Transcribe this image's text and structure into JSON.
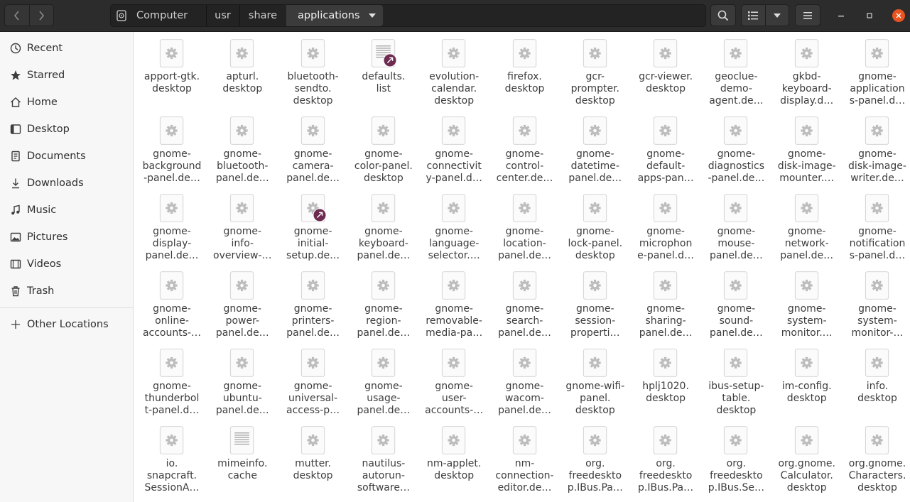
{
  "path": [
    "Computer",
    "usr",
    "share",
    "applications"
  ],
  "sidebar": [
    {
      "label": "Recent",
      "icon": "clock-icon"
    },
    {
      "label": "Starred",
      "icon": "star-icon"
    },
    {
      "label": "Home",
      "icon": "home-icon"
    },
    {
      "label": "Desktop",
      "icon": "desktop-icon"
    },
    {
      "label": "Documents",
      "icon": "documents-icon"
    },
    {
      "label": "Downloads",
      "icon": "downloads-icon"
    },
    {
      "label": "Music",
      "icon": "music-icon"
    },
    {
      "label": "Pictures",
      "icon": "pictures-icon"
    },
    {
      "label": "Videos",
      "icon": "videos-icon"
    },
    {
      "label": "Trash",
      "icon": "trash-icon"
    },
    {
      "label": "Other Locations",
      "icon": "plus-icon"
    }
  ],
  "files": [
    {
      "name": "apport-gtk.\ndesktop",
      "type": "desktop"
    },
    {
      "name": "apturl.\ndesktop",
      "type": "desktop"
    },
    {
      "name": "bluetooth-\nsendto.\ndesktop",
      "type": "desktop"
    },
    {
      "name": "defaults.\nlist",
      "type": "text-link"
    },
    {
      "name": "evolution-\ncalendar.\ndesktop",
      "type": "desktop"
    },
    {
      "name": "firefox.\ndesktop",
      "type": "desktop"
    },
    {
      "name": "gcr-\nprompter.\ndesktop",
      "type": "desktop"
    },
    {
      "name": "gcr-viewer.\ndesktop",
      "type": "desktop"
    },
    {
      "name": "geoclue-\ndemo-\nagent.de…",
      "type": "desktop"
    },
    {
      "name": "gkbd-\nkeyboard-\ndisplay.d…",
      "type": "desktop"
    },
    {
      "name": "gnome-\napplication\ns-panel.d…",
      "type": "desktop"
    },
    {
      "name": "gnome-\nbackground\n-panel.de…",
      "type": "desktop"
    },
    {
      "name": "gnome-\nbluetooth-\npanel.de…",
      "type": "desktop"
    },
    {
      "name": "gnome-\ncamera-\npanel.de…",
      "type": "desktop"
    },
    {
      "name": "gnome-\ncolor-panel.\ndesktop",
      "type": "desktop"
    },
    {
      "name": "gnome-\nconnectivit\ny-panel.d…",
      "type": "desktop"
    },
    {
      "name": "gnome-\ncontrol-\ncenter.de…",
      "type": "desktop"
    },
    {
      "name": "gnome-\ndatetime-\npanel.de…",
      "type": "desktop"
    },
    {
      "name": "gnome-\ndefault-\napps-pan…",
      "type": "desktop"
    },
    {
      "name": "gnome-\ndiagnostics\n-panel.de…",
      "type": "desktop"
    },
    {
      "name": "gnome-\ndisk-image-\nmounter.…",
      "type": "desktop"
    },
    {
      "name": "gnome-\ndisk-image-\nwriter.de…",
      "type": "desktop"
    },
    {
      "name": "gnome-\ndisplay-\npanel.de…",
      "type": "desktop"
    },
    {
      "name": "gnome-\ninfo-\noverview-…",
      "type": "desktop"
    },
    {
      "name": "gnome-\ninitial-\nsetup.de…",
      "type": "desktop-link"
    },
    {
      "name": "gnome-\nkeyboard-\npanel.de…",
      "type": "desktop"
    },
    {
      "name": "gnome-\nlanguage-\nselector.…",
      "type": "desktop"
    },
    {
      "name": "gnome-\nlocation-\npanel.de…",
      "type": "desktop"
    },
    {
      "name": "gnome-\nlock-panel.\ndesktop",
      "type": "desktop"
    },
    {
      "name": "gnome-\nmicrophon\ne-panel.d…",
      "type": "desktop"
    },
    {
      "name": "gnome-\nmouse-\npanel.de…",
      "type": "desktop"
    },
    {
      "name": "gnome-\nnetwork-\npanel.de…",
      "type": "desktop"
    },
    {
      "name": "gnome-\nnotification\ns-panel.d…",
      "type": "desktop"
    },
    {
      "name": "gnome-\nonline-\naccounts-…",
      "type": "desktop"
    },
    {
      "name": "gnome-\npower-\npanel.de…",
      "type": "desktop"
    },
    {
      "name": "gnome-\nprinters-\npanel.de…",
      "type": "desktop"
    },
    {
      "name": "gnome-\nregion-\npanel.de…",
      "type": "desktop"
    },
    {
      "name": "gnome-\nremovable-\nmedia-pa…",
      "type": "desktop"
    },
    {
      "name": "gnome-\nsearch-\npanel.de…",
      "type": "desktop"
    },
    {
      "name": "gnome-\nsession-\nproperti…",
      "type": "desktop"
    },
    {
      "name": "gnome-\nsharing-\npanel.de…",
      "type": "desktop"
    },
    {
      "name": "gnome-\nsound-\npanel.de…",
      "type": "desktop"
    },
    {
      "name": "gnome-\nsystem-\nmonitor.…",
      "type": "desktop"
    },
    {
      "name": "gnome-\nsystem-\nmonitor-…",
      "type": "desktop"
    },
    {
      "name": "gnome-\nthunderbol\nt-panel.d…",
      "type": "desktop"
    },
    {
      "name": "gnome-\nubuntu-\npanel.de…",
      "type": "desktop"
    },
    {
      "name": "gnome-\nuniversal-\naccess-p…",
      "type": "desktop"
    },
    {
      "name": "gnome-\nusage-\npanel.de…",
      "type": "desktop"
    },
    {
      "name": "gnome-\nuser-\naccounts-…",
      "type": "desktop"
    },
    {
      "name": "gnome-\nwacom-\npanel.de…",
      "type": "desktop"
    },
    {
      "name": "gnome-wifi-\npanel.\ndesktop",
      "type": "desktop"
    },
    {
      "name": "hplj1020.\ndesktop",
      "type": "desktop"
    },
    {
      "name": "ibus-setup-\ntable.\ndesktop",
      "type": "desktop"
    },
    {
      "name": "im-config.\ndesktop",
      "type": "desktop"
    },
    {
      "name": "info.\ndesktop",
      "type": "desktop"
    },
    {
      "name": "io.\nsnapcraft.\nSessionA…",
      "type": "desktop"
    },
    {
      "name": "mimeinfo.\ncache",
      "type": "text"
    },
    {
      "name": "mutter.\ndesktop",
      "type": "desktop"
    },
    {
      "name": "nautilus-\nautorun-\nsoftware…",
      "type": "desktop"
    },
    {
      "name": "nm-applet.\ndesktop",
      "type": "desktop"
    },
    {
      "name": "nm-\nconnection-\neditor.de…",
      "type": "desktop"
    },
    {
      "name": "org.\nfreedeskto\np.IBus.Pa…",
      "type": "desktop"
    },
    {
      "name": "org.\nfreedeskto\np.IBus.Pa…",
      "type": "desktop"
    },
    {
      "name": "org.\nfreedeskto\np.IBus.Se…",
      "type": "desktop"
    },
    {
      "name": "org.gnome.\nCalculator.\ndesktop",
      "type": "desktop"
    },
    {
      "name": "org.gnome.\nCharacters.\ndesktop",
      "type": "desktop"
    }
  ]
}
